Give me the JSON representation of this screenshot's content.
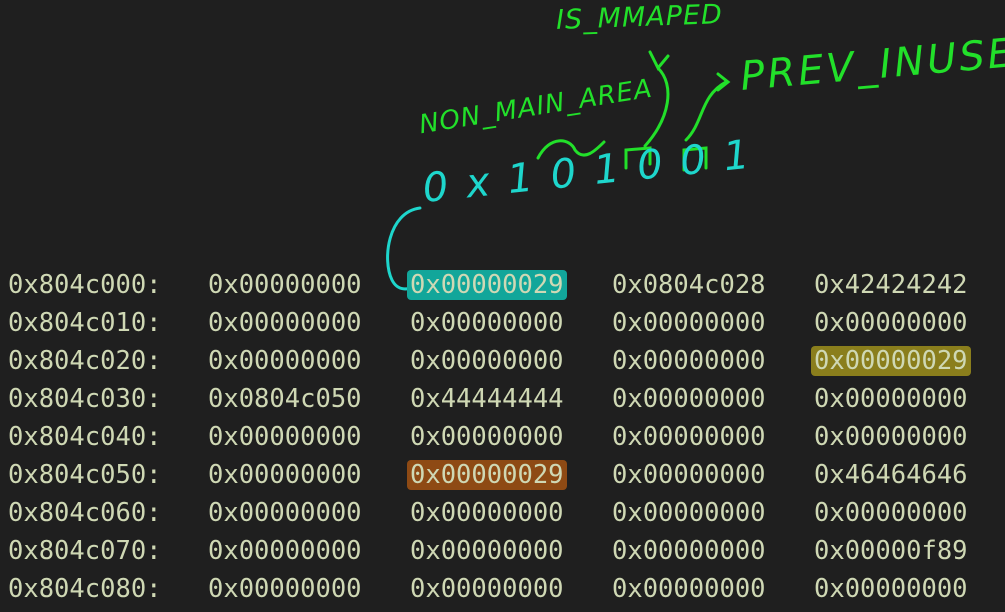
{
  "annotations": {
    "is_mmaped": "IS_MMAPED",
    "non_main_area": "NON_MAIN_AREA",
    "prev_inuse": "PREV_INUSE",
    "bits": "0x101001",
    "colors": {
      "label": "#22e02a",
      "bits": "#1ed6cc"
    }
  },
  "memory_dump": {
    "rows": [
      {
        "address": "0x804c000:",
        "words": [
          "0x00000000",
          "0x00000029",
          "0x0804c028",
          "0x42424242"
        ]
      },
      {
        "address": "0x804c010:",
        "words": [
          "0x00000000",
          "0x00000000",
          "0x00000000",
          "0x00000000"
        ]
      },
      {
        "address": "0x804c020:",
        "words": [
          "0x00000000",
          "0x00000000",
          "0x00000000",
          "0x00000029"
        ]
      },
      {
        "address": "0x804c030:",
        "words": [
          "0x0804c050",
          "0x44444444",
          "0x00000000",
          "0x00000000"
        ]
      },
      {
        "address": "0x804c040:",
        "words": [
          "0x00000000",
          "0x00000000",
          "0x00000000",
          "0x00000000"
        ]
      },
      {
        "address": "0x804c050:",
        "words": [
          "0x00000000",
          "0x00000029",
          "0x00000000",
          "0x46464646"
        ]
      },
      {
        "address": "0x804c060:",
        "words": [
          "0x00000000",
          "0x00000000",
          "0x00000000",
          "0x00000000"
        ]
      },
      {
        "address": "0x804c070:",
        "words": [
          "0x00000000",
          "0x00000000",
          "0x00000000",
          "0x00000f89"
        ]
      },
      {
        "address": "0x804c080:",
        "words": [
          "0x00000000",
          "0x00000000",
          "0x00000000",
          "0x00000000"
        ]
      }
    ],
    "highlights": [
      {
        "row": 0,
        "col": 1,
        "color": "teal"
      },
      {
        "row": 2,
        "col": 3,
        "color": "yellow"
      },
      {
        "row": 5,
        "col": 1,
        "color": "orange"
      }
    ],
    "colors": {
      "text": "#cfd8b4",
      "background": "#1f1f1f",
      "teal": "#12a69a",
      "yellow": "#8a7e1c",
      "orange": "#8e4a14"
    }
  }
}
